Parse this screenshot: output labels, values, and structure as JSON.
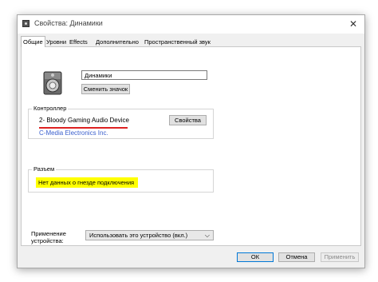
{
  "window": {
    "title": "Свойства: Динамики",
    "close_glyph": "✕"
  },
  "tabs": [
    "Общие",
    "Уровни",
    "Effects",
    "Дополнительно",
    "Пространственный звук"
  ],
  "general": {
    "device_name_value": "Динамики",
    "change_icon_label": "Сменить значок",
    "controller": {
      "title": "Контроллер",
      "device": "2- Bloody Gaming Audio Device",
      "vendor": "C-Media Electronics Inc.",
      "properties_label": "Свойства"
    },
    "jack": {
      "title": "Разъем",
      "info": "Нет данных о гнезде подключения"
    },
    "apply": {
      "label": "Применение устройства:",
      "value": "Использовать это устройство (вкл.)"
    }
  },
  "footer": {
    "ok": "ОК",
    "cancel": "Отмена",
    "apply": "Применить"
  },
  "colors": {
    "highlight": "#ffff00",
    "underline": "#dd2222",
    "vendor_link": "#3a5fcd"
  }
}
